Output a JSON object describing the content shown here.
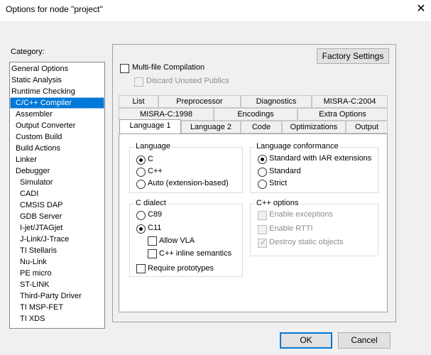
{
  "window": {
    "title": "Options for node \"project\"",
    "close_glyph": "✕"
  },
  "category": {
    "label": "Category:",
    "items": [
      "General Options",
      "Static Analysis",
      "Runtime Checking",
      "C/C++ Compiler",
      "Assembler",
      "Output Converter",
      "Custom Build",
      "Build Actions",
      "Linker",
      "Debugger",
      "Simulator",
      "CADI",
      "CMSIS DAP",
      "GDB Server",
      "I-jet/JTAGjet",
      "J-Link/J-Trace",
      "TI Stellaris",
      "Nu-Link",
      "PE micro",
      "ST-LINK",
      "Third-Party Driver",
      "TI MSP-FET",
      "TI XDS"
    ],
    "selected": "C/C++ Compiler"
  },
  "factory_settings": "Factory Settings",
  "multi_file": {
    "label": "Multi-file Compilation",
    "checked": false
  },
  "discard_unused": {
    "label": "Discard Unused Publics",
    "checked": false,
    "disabled": true
  },
  "tabs": {
    "row1": [
      "List",
      "Preprocessor",
      "Diagnostics",
      "MISRA-C:2004"
    ],
    "row2": [
      "MISRA-C:1998",
      "Encodings",
      "Extra Options"
    ],
    "row3": [
      "Language 1",
      "Language 2",
      "Code",
      "Optimizations",
      "Output"
    ],
    "active": "Language 1"
  },
  "language_group": {
    "title": "Language",
    "options": [
      "C",
      "C++",
      "Auto (extension-based)"
    ],
    "selected": "C"
  },
  "conformance_group": {
    "title": "Language conformance",
    "options": [
      "Standard with IAR extensions",
      "Standard",
      "Strict"
    ],
    "selected": "Standard with IAR extensions"
  },
  "dialect_group": {
    "title": "C dialect",
    "options": [
      "C89",
      "C11"
    ],
    "selected": "C11",
    "allow_vla": "Allow VLA",
    "cpp_inline": "C++ inline semantics",
    "require_prototypes": "Require prototypes"
  },
  "cpp_options_group": {
    "title": "C++ options",
    "enable_exceptions": "Enable exceptions",
    "enable_rtti": "Enable RTTI",
    "destroy_static": "Destroy static objects",
    "check_glyph": "✓"
  },
  "buttons": {
    "ok": "OK",
    "cancel": "Cancel"
  }
}
